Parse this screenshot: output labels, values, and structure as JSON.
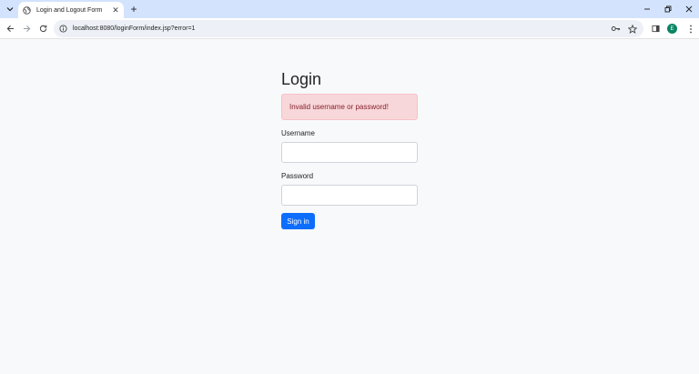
{
  "browser": {
    "tab_title": "Login and Logout Form",
    "url": "localhost:8080/loginForm/index.jsp?error=1",
    "profile_initial": "E"
  },
  "page": {
    "heading": "Login",
    "error_message": "Invalid username or password!",
    "username_label": "Username",
    "username_value": "",
    "password_label": "Password",
    "password_value": "",
    "submit_label": "Sign in"
  },
  "colors": {
    "tabstrip": "#d3e3fd",
    "alert_bg": "#f8d7da",
    "alert_text": "#842029",
    "primary": "#0d6efd",
    "avatar": "#0b8564"
  },
  "icons": [
    "tab-search-icon",
    "globe-icon",
    "close-icon",
    "plus-icon",
    "minimize-icon",
    "restore-icon",
    "back-arrow-icon",
    "forward-arrow-icon",
    "reload-icon",
    "info-icon",
    "password-key-icon",
    "star-icon",
    "side-panel-icon",
    "more-vert-icon"
  ]
}
